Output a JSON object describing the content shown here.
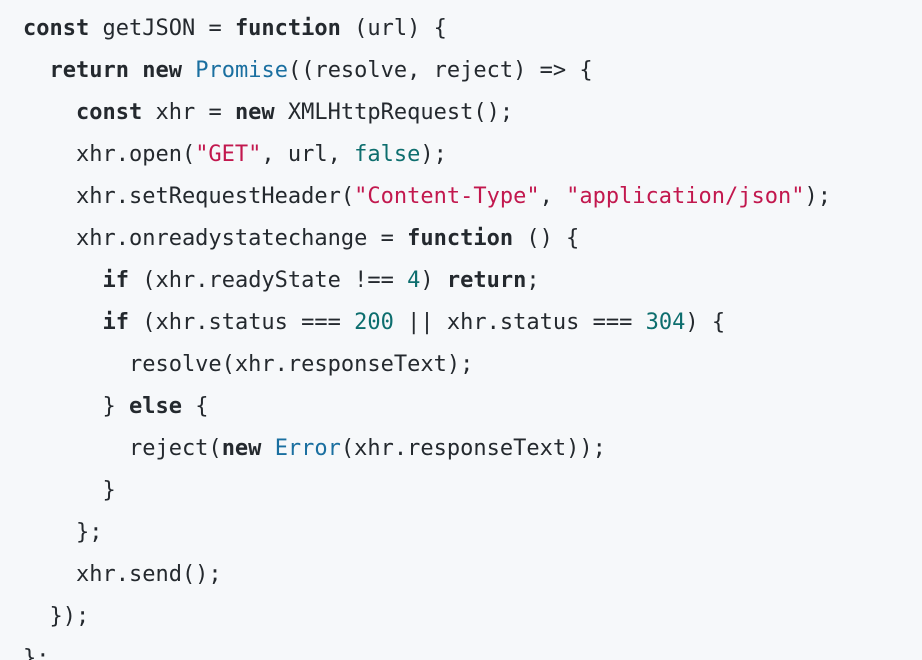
{
  "code_block": {
    "language": "javascript",
    "colors": {
      "background": "#f6f8fa",
      "text": "#24292e",
      "keyword": "#24292e",
      "builtin": "#1a6fa0",
      "string": "#c2184e",
      "number": "#0d6e6e"
    },
    "lines": [
      [
        {
          "t": "kw",
          "v": "const"
        },
        {
          "t": "plain",
          "v": " getJSON = "
        },
        {
          "t": "kw",
          "v": "function"
        },
        {
          "t": "plain",
          "v": " (url) {"
        }
      ],
      [
        {
          "t": "plain",
          "v": "  "
        },
        {
          "t": "kw",
          "v": "return"
        },
        {
          "t": "plain",
          "v": " "
        },
        {
          "t": "kw",
          "v": "new"
        },
        {
          "t": "plain",
          "v": " "
        },
        {
          "t": "builtin",
          "v": "Promise"
        },
        {
          "t": "plain",
          "v": "((resolve, reject) => {"
        }
      ],
      [
        {
          "t": "plain",
          "v": "    "
        },
        {
          "t": "kw",
          "v": "const"
        },
        {
          "t": "plain",
          "v": " xhr = "
        },
        {
          "t": "kw",
          "v": "new"
        },
        {
          "t": "plain",
          "v": " XMLHttpRequest();"
        }
      ],
      [
        {
          "t": "plain",
          "v": "    xhr.open("
        },
        {
          "t": "str",
          "v": "\"GET\""
        },
        {
          "t": "plain",
          "v": ", url, "
        },
        {
          "t": "bool",
          "v": "false"
        },
        {
          "t": "plain",
          "v": ");"
        }
      ],
      [
        {
          "t": "plain",
          "v": "    xhr.setRequestHeader("
        },
        {
          "t": "str",
          "v": "\"Content-Type\""
        },
        {
          "t": "plain",
          "v": ", "
        },
        {
          "t": "str",
          "v": "\"application/json\""
        },
        {
          "t": "plain",
          "v": ");"
        }
      ],
      [
        {
          "t": "plain",
          "v": "    xhr.onreadystatechange = "
        },
        {
          "t": "kw",
          "v": "function"
        },
        {
          "t": "plain",
          "v": " () {"
        }
      ],
      [
        {
          "t": "plain",
          "v": "      "
        },
        {
          "t": "kw",
          "v": "if"
        },
        {
          "t": "plain",
          "v": " (xhr.readyState !== "
        },
        {
          "t": "num",
          "v": "4"
        },
        {
          "t": "plain",
          "v": ") "
        },
        {
          "t": "kw",
          "v": "return"
        },
        {
          "t": "plain",
          "v": ";"
        }
      ],
      [
        {
          "t": "plain",
          "v": "      "
        },
        {
          "t": "kw",
          "v": "if"
        },
        {
          "t": "plain",
          "v": " (xhr.status === "
        },
        {
          "t": "num",
          "v": "200"
        },
        {
          "t": "plain",
          "v": " || xhr.status === "
        },
        {
          "t": "num",
          "v": "304"
        },
        {
          "t": "plain",
          "v": ") {"
        }
      ],
      [
        {
          "t": "plain",
          "v": "        resolve(xhr.responseText);"
        }
      ],
      [
        {
          "t": "plain",
          "v": "      } "
        },
        {
          "t": "kw",
          "v": "else"
        },
        {
          "t": "plain",
          "v": " {"
        }
      ],
      [
        {
          "t": "plain",
          "v": "        reject("
        },
        {
          "t": "kw",
          "v": "new"
        },
        {
          "t": "plain",
          "v": " "
        },
        {
          "t": "builtin",
          "v": "Error"
        },
        {
          "t": "plain",
          "v": "(xhr.responseText));"
        }
      ],
      [
        {
          "t": "plain",
          "v": "      }"
        }
      ],
      [
        {
          "t": "plain",
          "v": "    };"
        }
      ],
      [
        {
          "t": "plain",
          "v": "    xhr.send();"
        }
      ],
      [
        {
          "t": "plain",
          "v": "  });"
        }
      ],
      [
        {
          "t": "plain",
          "v": "};"
        }
      ]
    ]
  }
}
